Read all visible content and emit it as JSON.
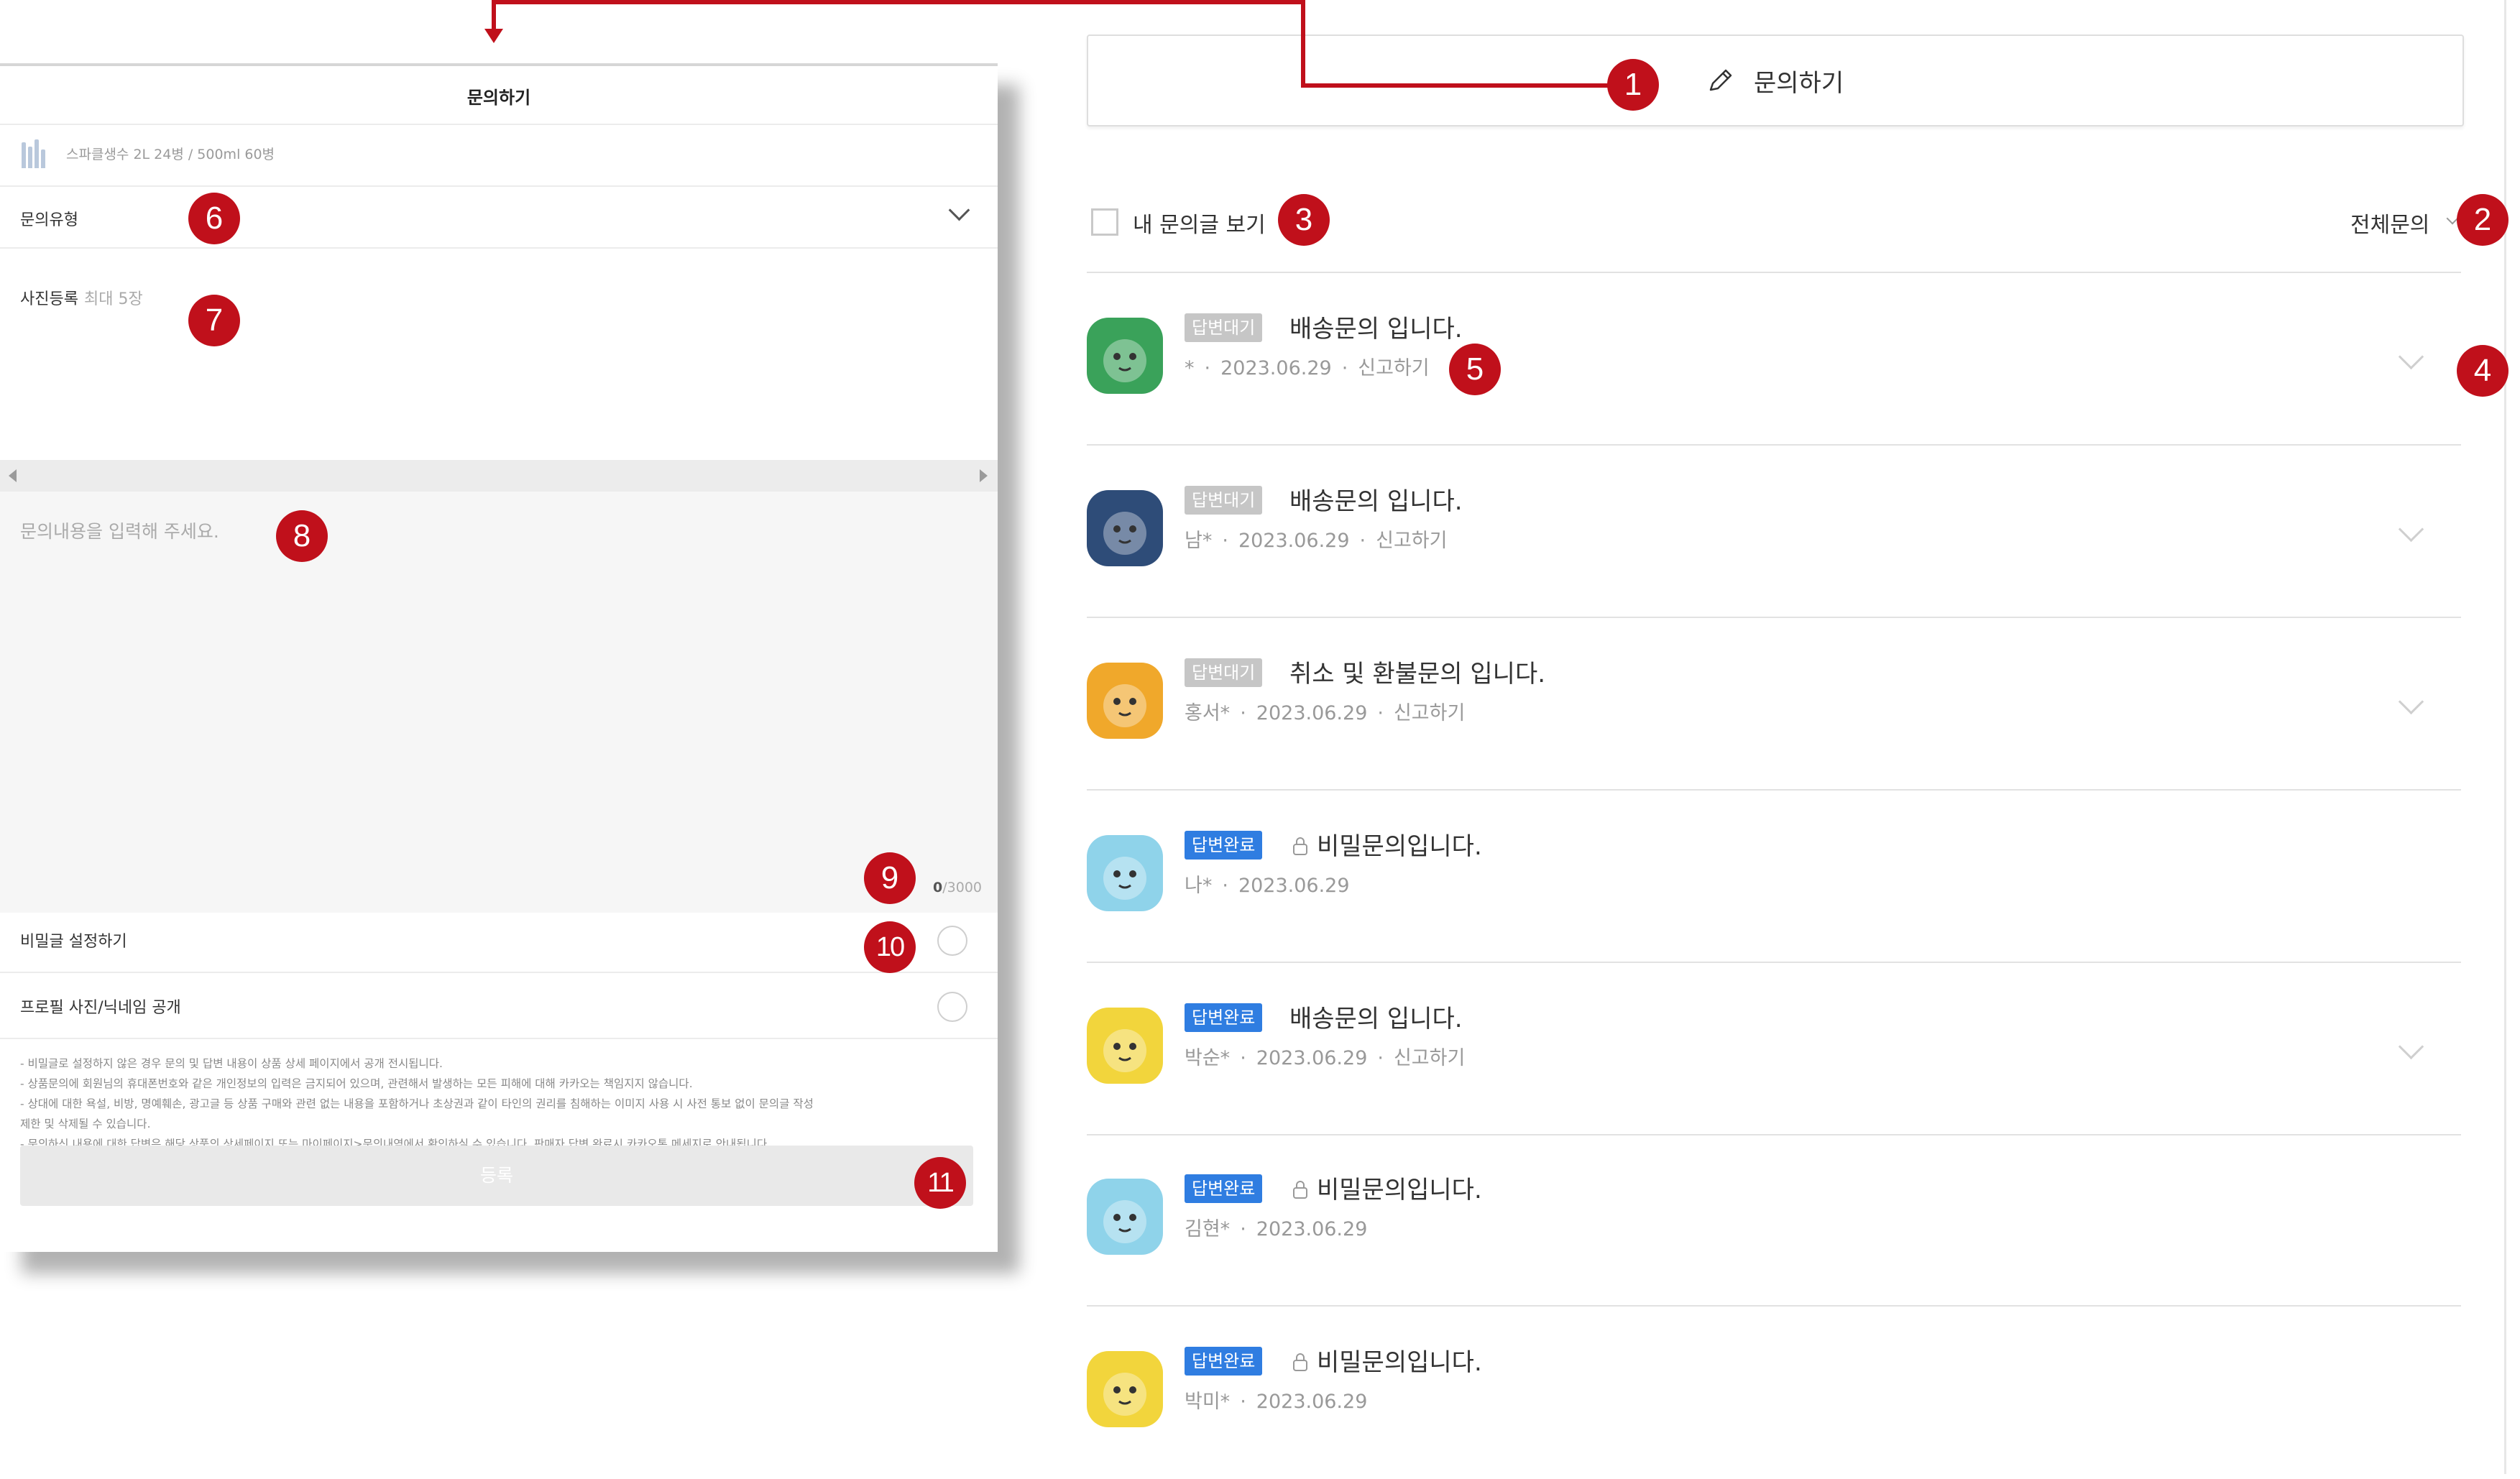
{
  "modal": {
    "title": "문의하기",
    "product_name": "스파클생수 2L 24병 / 500ml 60병",
    "inquiry_type_label": "문의유형",
    "photo_label": "사진등록",
    "photo_hint": "최대 5장",
    "content_placeholder": "문의내용을 입력해 주세요.",
    "char_count_current": "0",
    "char_count_max": "/3000",
    "secret_label": "비밀글 설정하기",
    "profile_label": "프로필 사진/닉네임 공개",
    "notices": [
      "- 비밀글로 설정하지 않은 경우 문의 및 답변 내용이 상품 상세 페이지에서 공개 전시됩니다.",
      "- 상품문의에 회원님의 휴대폰번호와 같은 개인정보의 입력은 금지되어 있으며, 관련해서 발생하는 모든 피해에 대해 카카오는 책임지지 않습니다.",
      "- 상대에 대한 욕설, 비방, 명예훼손, 광고글 등 상품 구매와 관련 없는 내용을 포함하거나 초상권과 같이 타인의 권리를 침해하는 이미지 사용 시 사전 통보 없이 문의글 작성",
      "  제한 및 삭제될 수 있습니다.",
      "- 문의하신 내용에 대한 답변은 해당 상품의 상세페이지 또는 마이페이지>문의내역에서 확인하실 수 있습니다. 판매자 답변 완료시 카카오톡 메세지로 안내됩니다."
    ],
    "submit_label": "등록"
  },
  "board": {
    "write_button_label": "문의하기",
    "my_posts_label": "내 문의글 보기",
    "filter_label": "전체문의",
    "items": [
      {
        "status": "답변대기",
        "status_type": "waiting",
        "title": "배송문의 입니다.",
        "secret": false,
        "author": "*",
        "date": "2023.06.29",
        "report": "신고하기",
        "avatar": "green",
        "expandable": true
      },
      {
        "status": "답변대기",
        "status_type": "waiting",
        "title": "배송문의 입니다.",
        "secret": false,
        "author": "남*",
        "date": "2023.06.29",
        "report": "신고하기",
        "avatar": "navy",
        "expandable": true
      },
      {
        "status": "답변대기",
        "status_type": "waiting",
        "title": "취소 및 환불문의 입니다.",
        "secret": false,
        "author": "홍서*",
        "date": "2023.06.29",
        "report": "신고하기",
        "avatar": "orange",
        "expandable": true
      },
      {
        "status": "답변완료",
        "status_type": "done",
        "title": "비밀문의입니다.",
        "secret": true,
        "author": "나*",
        "date": "2023.06.29",
        "report": "",
        "avatar": "cyan",
        "expandable": false
      },
      {
        "status": "답변완료",
        "status_type": "done",
        "title": "배송문의 입니다.",
        "secret": false,
        "author": "박순*",
        "date": "2023.06.29",
        "report": "신고하기",
        "avatar": "yellow",
        "expandable": true
      },
      {
        "status": "답변완료",
        "status_type": "done",
        "title": "비밀문의입니다.",
        "secret": true,
        "author": "김현*",
        "date": "2023.06.29",
        "report": "",
        "avatar": "cyan",
        "expandable": false
      },
      {
        "status": "답변완료",
        "status_type": "done",
        "title": "비밀문의입니다.",
        "secret": true,
        "author": "박미*",
        "date": "2023.06.29",
        "report": "",
        "avatar": "yellow",
        "expandable": false
      }
    ]
  },
  "markers": [
    "1",
    "2",
    "3",
    "4",
    "5",
    "6",
    "7",
    "8",
    "9",
    "10",
    "11"
  ],
  "colors": {
    "annotation_red": "#c0101b",
    "badge_waiting": "#c6c6c6",
    "badge_done": "#2f7de1",
    "avatar_green": "#3aa25a",
    "avatar_navy": "#2e4c78",
    "avatar_orange": "#f0a82b",
    "avatar_cyan": "#8fd3ea",
    "avatar_yellow": "#f2d53c"
  },
  "icons": [
    "pencil-icon",
    "lock-icon",
    "chevron-down-icon",
    "product-thumbnail",
    "avatar"
  ]
}
